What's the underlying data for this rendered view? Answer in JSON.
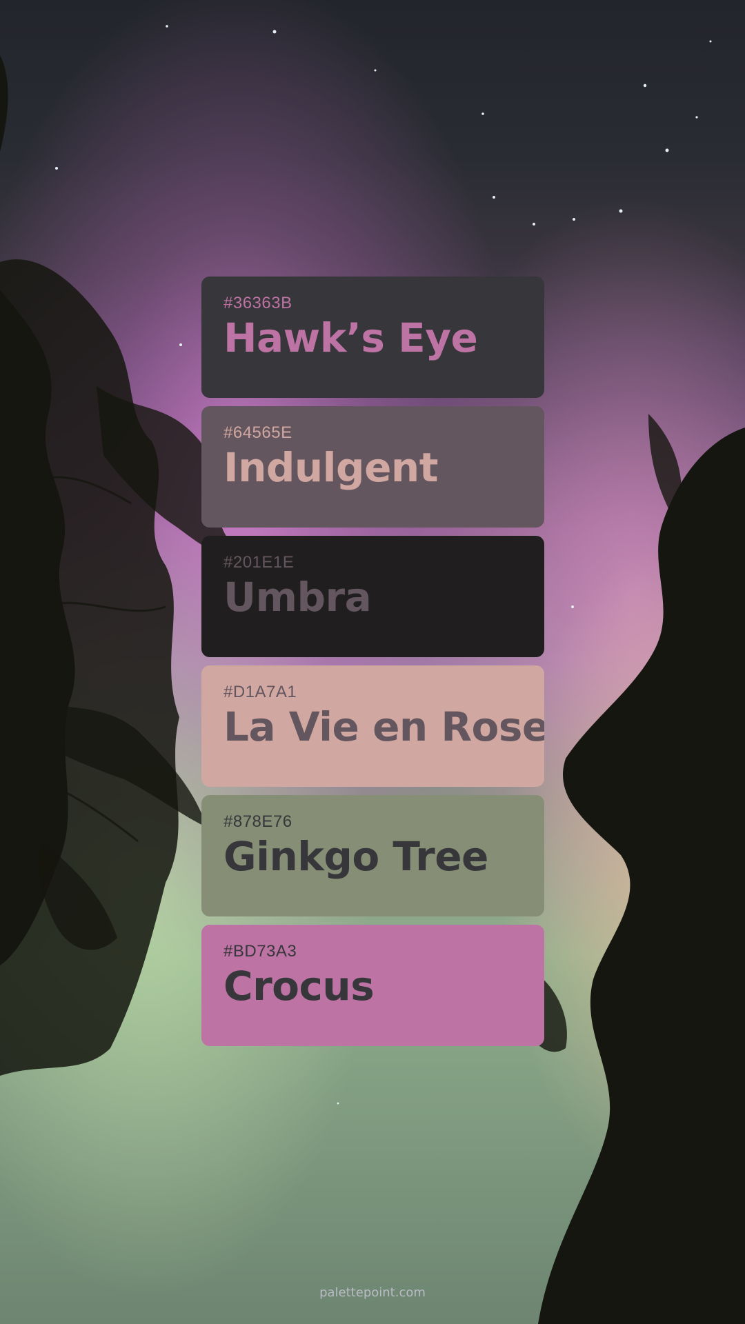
{
  "background": {
    "sky_colors": [
      "#23262d",
      "#4a3a55",
      "#b070b0",
      "#c98fc0",
      "#b9c9a2",
      "#9fb895",
      "#e7b9a2"
    ],
    "silhouette_color": "#141511"
  },
  "swatches": [
    {
      "hex_label": "#36363B",
      "name": "Hawk’s Eye",
      "bg": "#36363B",
      "text_color": "#BD73A3"
    },
    {
      "hex_label": "#64565E",
      "name": "Indulgent",
      "bg": "#64565E",
      "text_color": "#D1A7A1"
    },
    {
      "hex_label": "#201E1E",
      "name": "Umbra",
      "bg": "#201E1E",
      "text_color": "#64565E"
    },
    {
      "hex_label": "#D1A7A1",
      "name": "La Vie en Rose",
      "bg": "#D1A7A1",
      "text_color": "#64565E"
    },
    {
      "hex_label": "#878E76",
      "name": "Ginkgo Tree",
      "bg": "#878E76",
      "text_color": "#36363B"
    },
    {
      "hex_label": "#BD73A3",
      "name": "Crocus",
      "bg": "#BD73A3",
      "text_color": "#36363B"
    }
  ],
  "footer": {
    "text": "palettepoint.com"
  }
}
